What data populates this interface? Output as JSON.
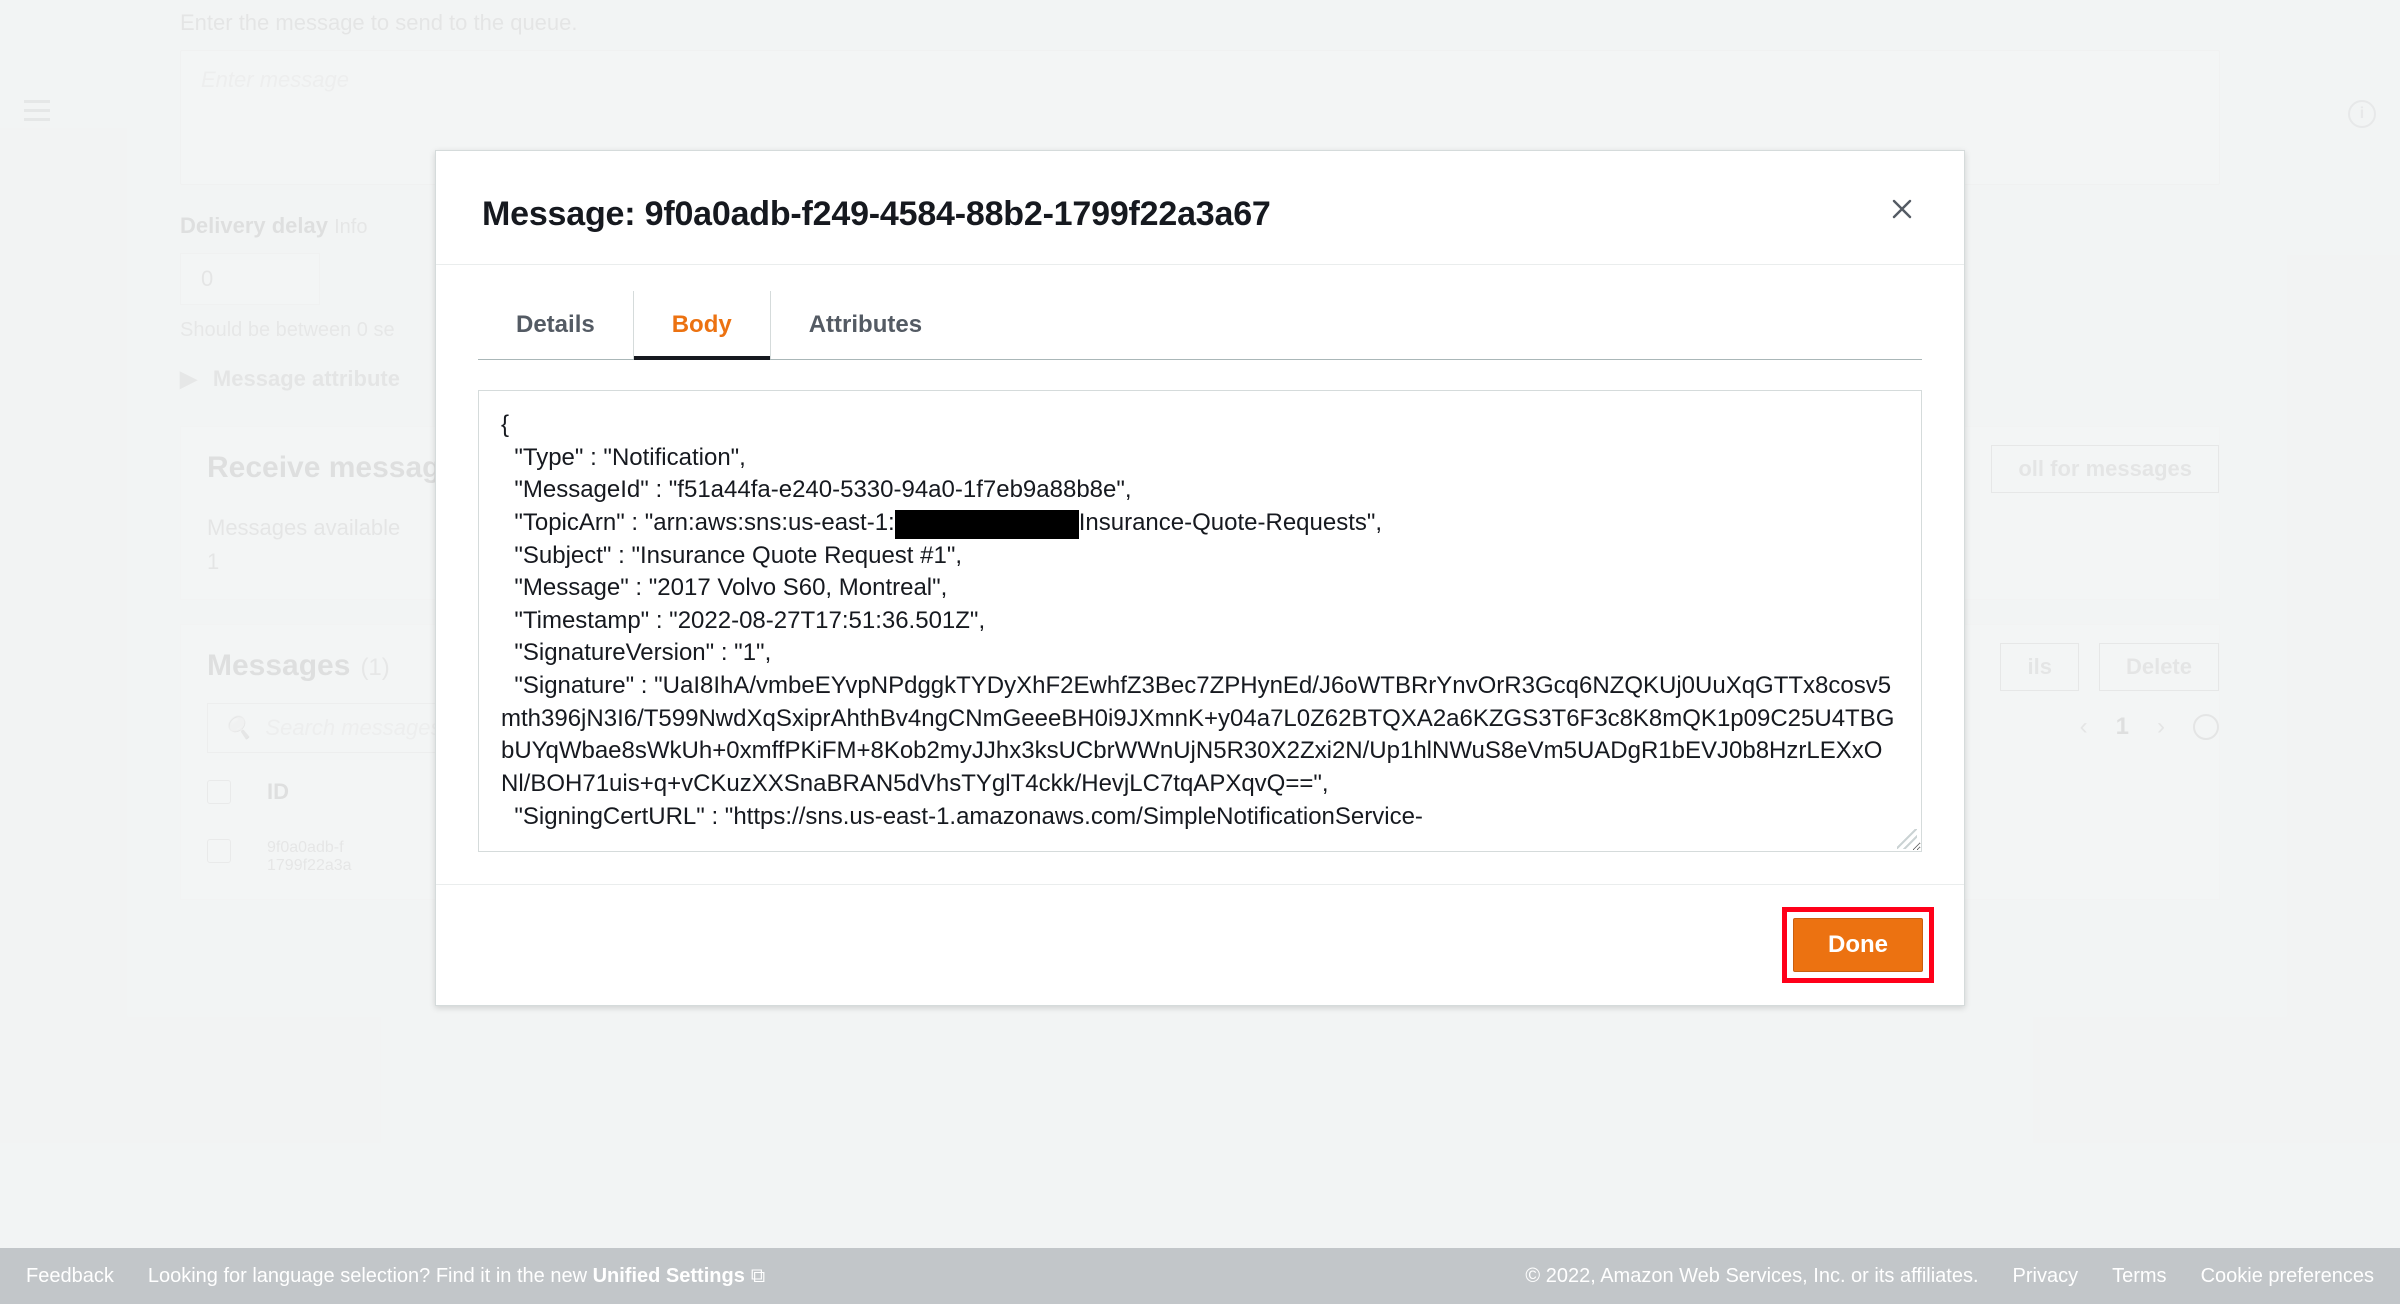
{
  "bg": {
    "hint": "Enter the message to send to the queue.",
    "input_placeholder": "Enter message",
    "delay_label": "Delivery delay",
    "info": "Info",
    "delay_value": "0",
    "hint2": "Should be between 0 se",
    "attr_label": "Message attribute",
    "panel1_title": "Receive messag",
    "avail_label": "Messages available",
    "avail_value": "1",
    "panel2_title": "Messages",
    "panel2_count": "(1)",
    "search_placeholder": "Search messages",
    "th_id": "ID",
    "row_id_line1": "9f0a0adb-f",
    "row_id_line2": "1799f22a3a",
    "btn_poll": "oll for messages",
    "btn_details": "ils",
    "btn_delete": "Delete",
    "page_num": "1"
  },
  "modal": {
    "title_prefix": "Message: ",
    "message_id": "9f0a0adb-f249-4584-88b2-1799f22a3a67",
    "tabs": {
      "details": "Details",
      "body": "Body",
      "attributes": "Attributes"
    },
    "body_part1": "{\n  \"Type\" : \"Notification\",\n  \"MessageId\" : \"f51a44fa-e240-5330-94a0-1f7eb9a88b8e\",\n  \"TopicArn\" : \"arn:aws:sns:us-east-1:",
    "body_part2": "Insurance-Quote-Requests\",\n  \"Subject\" : \"Insurance Quote Request #1\",\n  \"Message\" : \"2017 Volvo S60, Montreal\",\n  \"Timestamp\" : \"2022-08-27T17:51:36.501Z\",\n  \"SignatureVersion\" : \"1\",\n  \"Signature\" : \"UaI8IhA/vmbeEYvpNPdggkTYDyXhF2EwhfZ3Bec7ZPHynEd/J6oWTBRrYnvOrR3Gcq6NZQKUj0UuXqGTTx8cosv5mth396jN3I6/T599NwdXqSxiprAhthBv4ngCNmGeeeBH0i9JXmnK+y04a7L0Z62BTQXA2a6KZGS3T6F3c8K8mQK1p09C25U4TBGbUYqWbae8sWkUh+0xmffPKiFM+8Kob2myJJhx3ksUCbrWWnUjN5R30X2Zxi2N/Up1hlNWuS8eVm5UADgR1bEVJ0b8HzrLEXxONl/BOH71uis+q+vCKuzXXSnaBRAN5dVhsTYglT4ckk/HevjLC7tqAPXqvQ==\",\n  \"SigningCertURL\" : \"https://sns.us-east-1.amazonaws.com/SimpleNotificationService-",
    "done": "Done"
  },
  "footer": {
    "feedback": "Feedback",
    "lang_msg": "Looking for language selection? Find it in the new ",
    "unified": "Unified Settings",
    "copyright": "© 2022, Amazon Web Services, Inc. or its affiliates.",
    "privacy": "Privacy",
    "terms": "Terms",
    "cookie": "Cookie preferences"
  }
}
